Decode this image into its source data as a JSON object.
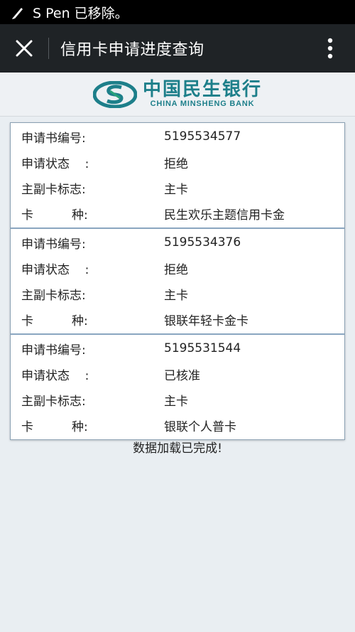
{
  "status_bar": {
    "message": "S Pen 已移除。",
    "icon": "pen-icon"
  },
  "app_bar": {
    "title": "信用卡申请进度查询",
    "close_icon": "close-icon",
    "more_icon": "more-vert-icon"
  },
  "logo": {
    "name_cn": "中国民生银行",
    "name_en": "CHINA MINSHENG BANK",
    "brand_color": "#1d7f8a"
  },
  "labels": {
    "app_no": "申请书编号:",
    "status": "申请状态    :",
    "primary": "主副卡标志:",
    "card_type": "卡          种:"
  },
  "records": [
    {
      "app_no": "5195534577",
      "status": "拒绝",
      "primary": "主卡",
      "card_type": "民生欢乐主题信用卡金"
    },
    {
      "app_no": "5195534376",
      "status": "拒绝",
      "primary": "主卡",
      "card_type": "银联年轻卡金卡"
    },
    {
      "app_no": "5195531544",
      "status": "已核准",
      "primary": "主卡",
      "card_type": "银联个人普卡"
    }
  ],
  "footer": {
    "message": "数据加载已完成!"
  }
}
